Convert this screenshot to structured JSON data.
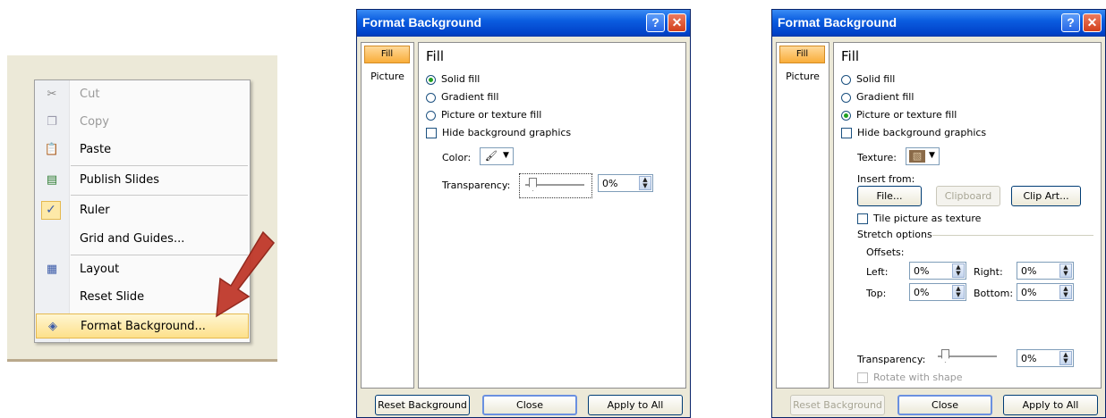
{
  "context_menu": {
    "items": [
      {
        "label": "Cut",
        "icon": "scissors-icon",
        "glyph": "✂",
        "disabled": true
      },
      {
        "label": "Copy",
        "icon": "copy-icon",
        "glyph": "❐",
        "disabled": true
      },
      {
        "label": "Paste",
        "icon": "clipboard-icon",
        "glyph": "📋",
        "disabled": false
      },
      {
        "label": "Publish Slides",
        "icon": "publish-slides-icon",
        "glyph": "▤",
        "disabled": false
      },
      {
        "label": "Ruler",
        "icon": "checkmark-icon",
        "glyph": "✓",
        "disabled": false
      },
      {
        "label": "Grid and Guides...",
        "icon": "",
        "glyph": "",
        "disabled": false
      },
      {
        "label": "Layout",
        "icon": "layout-icon",
        "glyph": "▦",
        "disabled": false
      },
      {
        "label": "Reset Slide",
        "icon": "",
        "glyph": "",
        "disabled": false
      },
      {
        "label": "Format Background...",
        "icon": "paint-bucket-icon",
        "glyph": "◈",
        "disabled": false
      }
    ]
  },
  "dialog1": {
    "title": "Format Background",
    "help": "?",
    "close": "✕",
    "nav": {
      "fill": "Fill",
      "picture": "Picture"
    },
    "heading": "Fill",
    "options": {
      "solid": "Solid fill",
      "gradient": "Gradient fill",
      "picture": "Picture or texture fill",
      "hide": "Hide background graphics"
    },
    "color_label": "Color:",
    "color_swatch": "🖌",
    "dropdown_arrow": "▼",
    "transparency_label": "Transparency:",
    "transparency_value": "0%",
    "buttons": {
      "reset": "Reset Background",
      "close": "Close",
      "apply": "Apply to All"
    }
  },
  "dialog2": {
    "title": "Format Background",
    "help": "?",
    "close": "✕",
    "nav": {
      "fill": "Fill",
      "picture": "Picture"
    },
    "heading": "Fill",
    "options": {
      "solid": "Solid fill",
      "gradient": "Gradient fill",
      "picture": "Picture or texture fill",
      "hide": "Hide background graphics"
    },
    "texture_label": "Texture:",
    "texture_swatch": "▧",
    "dropdown_arrow": "▼",
    "insert_from": "Insert from:",
    "file_btn": "File...",
    "clipboard_btn": "Clipboard",
    "clipart_btn": "Clip Art...",
    "tile": "Tile picture as texture",
    "stretch_options": "Stretch options",
    "offsets": "Offsets:",
    "left_label": "Left:",
    "left_value": "0%",
    "right_label": "Right:",
    "right_value": "0%",
    "top_label": "Top:",
    "top_value": "0%",
    "bottom_label": "Bottom:",
    "bottom_value": "0%",
    "transparency_label": "Transparency:",
    "transparency_value": "0%",
    "rotate": "Rotate with shape",
    "buttons": {
      "reset": "Reset Background",
      "close": "Close",
      "apply": "Apply to All"
    }
  },
  "colors": {
    "arrow": "#c0392b",
    "accent": "#0b5de0"
  }
}
